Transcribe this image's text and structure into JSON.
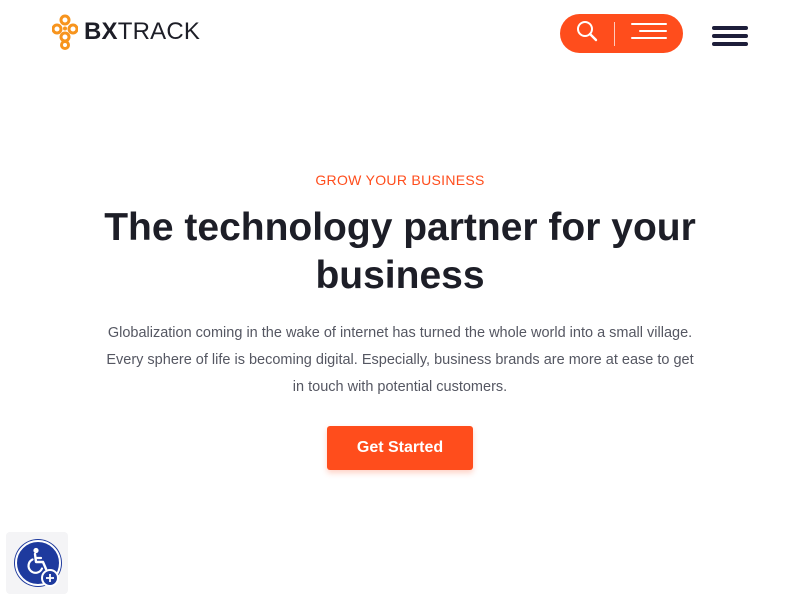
{
  "header": {
    "logo": {
      "bold_text": "BX",
      "light_text": "TRACK",
      "icon": "molecule-logo-icon"
    },
    "action_pill": {
      "search_icon": "search-icon",
      "menu_icon": "menu-lines-icon"
    },
    "hamburger_icon": "hamburger-menu-icon"
  },
  "hero": {
    "eyebrow": "GROW YOUR BUSINESS",
    "headline": "The technology partner for your business",
    "description": "Globalization coming in the wake of internet has turned the whole world into a small village. Every sphere of life is becoming digital. Especially, business brands are more at ease to get in touch with potential customers.",
    "cta_label": "Get Started"
  },
  "accessibility_widget": {
    "icon": "wheelchair-icon",
    "badge_icon": "plus-icon"
  },
  "colors": {
    "accent": "#ff4d1c",
    "heading": "#1d1e27",
    "body_text": "#555762",
    "accessibility_blue": "#1e3a9e",
    "hamburger": "#1d1e3a"
  }
}
